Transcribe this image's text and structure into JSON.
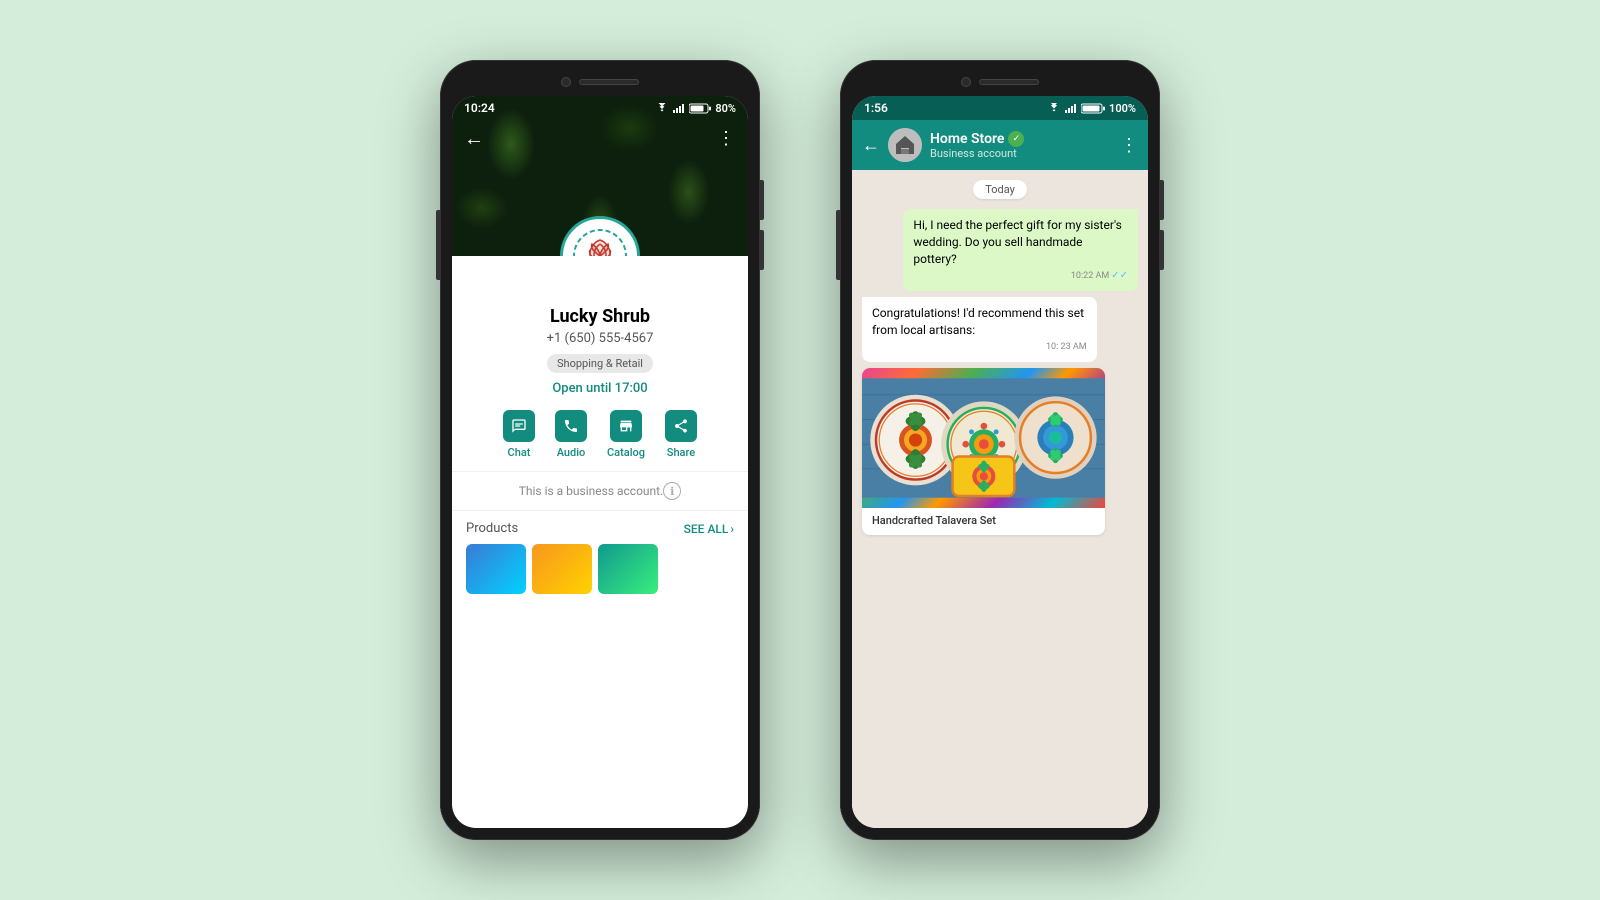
{
  "bg_color": "#d4edda",
  "phone1": {
    "status_bar": {
      "time": "10:24",
      "battery": "80%",
      "bg": "#1a1a1a"
    },
    "profile": {
      "name": "Lucky Shrub",
      "phone": "+1 (650) 555-4567",
      "tag": "Shopping & Retail",
      "hours": "Open until 17:00",
      "actions": [
        {
          "icon": "chat",
          "label": "Chat"
        },
        {
          "icon": "audio",
          "label": "Audio"
        },
        {
          "icon": "catalog",
          "label": "Catalog"
        },
        {
          "icon": "share",
          "label": "Share"
        }
      ],
      "business_notice": "This is a business account.",
      "products_title": "Products",
      "see_all": "SEE ALL"
    }
  },
  "phone2": {
    "status_bar": {
      "time": "1:56",
      "battery": "100%"
    },
    "chat": {
      "name": "Home Store",
      "subtitle": "Business account",
      "date_chip": "Today",
      "messages": [
        {
          "type": "sent",
          "text": "Hi, I need the perfect gift for my sister's wedding. Do you sell handmade pottery?",
          "time": "10:22 AM",
          "ticks": true
        },
        {
          "type": "received",
          "text": "Congratulations! I'd recommend this set from local artisans:",
          "time": "10: 23 AM"
        }
      ],
      "product": {
        "name": "Handcrafted Talavera Set"
      }
    }
  }
}
